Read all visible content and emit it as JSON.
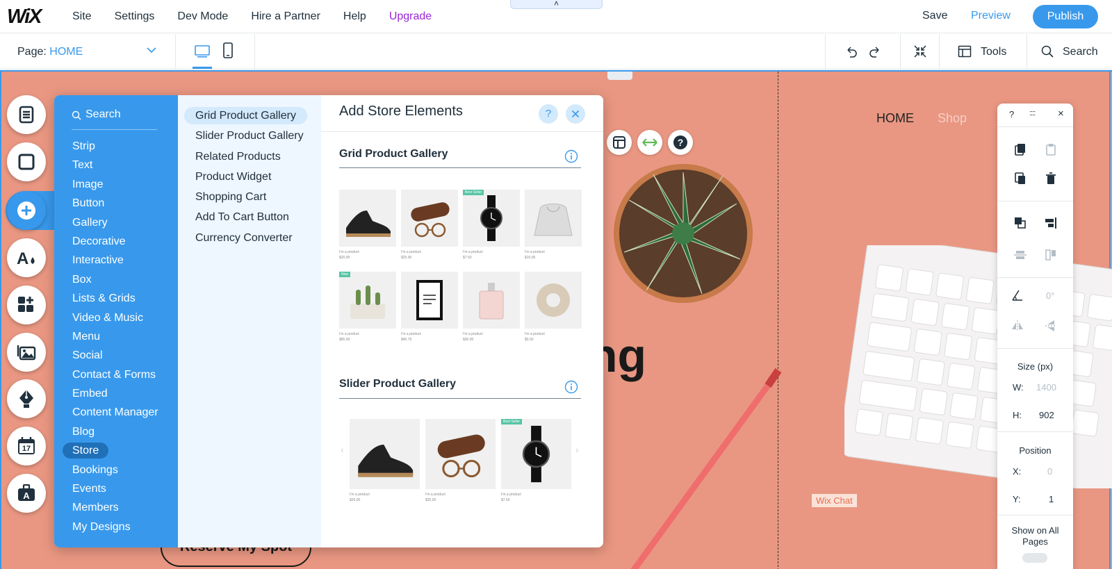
{
  "topbar": {
    "logo": "WiX",
    "menu": [
      "Site",
      "Settings",
      "Dev Mode",
      "Hire a Partner",
      "Help",
      "Upgrade"
    ],
    "collapse_glyph": "˄",
    "save": "Save",
    "preview": "Preview",
    "publish": "Publish"
  },
  "secondbar": {
    "page_prefix": "Page:",
    "page_name": "HOME",
    "tools": "Tools",
    "search": "Search"
  },
  "site": {
    "nav": [
      "HOME",
      "Shop"
    ],
    "headline_fragment": "ng",
    "cta": "Reserve My Spot",
    "chat_label": "Wix Chat"
  },
  "add_panel": {
    "search_placeholder": "Search",
    "categories": [
      "Strip",
      "Text",
      "Image",
      "Button",
      "Gallery",
      "Decorative",
      "Interactive",
      "Box",
      "Lists & Grids",
      "Video & Music",
      "Menu",
      "Social",
      "Contact & Forms",
      "Embed",
      "Content Manager",
      "Blog",
      "Store",
      "Bookings",
      "Events",
      "Members",
      "My Designs"
    ],
    "active_category": "Store",
    "subcategories": [
      "Grid Product Gallery",
      "Slider Product Gallery",
      "Related Products",
      "Product Widget",
      "Shopping Cart",
      "Add To Cart Button",
      "Currency Converter"
    ],
    "active_subcategory": "Grid Product Gallery",
    "title": "Add Store Elements",
    "help": "?",
    "sections": [
      {
        "title": "Grid Product Gallery"
      },
      {
        "title": "Slider Product Gallery"
      }
    ],
    "grid_products": [
      {
        "caption": "I'm a product",
        "price": "$20.00",
        "badge": ""
      },
      {
        "caption": "I'm a product",
        "price": "$25.00",
        "badge": ""
      },
      {
        "caption": "I'm a product",
        "price": "$7.50",
        "badge": "Best Seller"
      },
      {
        "caption": "I'm a product",
        "price": "$15.00",
        "badge": ""
      },
      {
        "caption": "I'm a product",
        "price": "$85.00",
        "badge": "New"
      },
      {
        "caption": "I'm a product",
        "price": "$40.75",
        "badge": ""
      },
      {
        "caption": "I'm a product",
        "price": "$30.00",
        "badge": ""
      },
      {
        "caption": "I'm a product",
        "price": "$9.50",
        "badge": ""
      }
    ],
    "slider_products": [
      {
        "caption": "I'm a product",
        "price": "$20.00",
        "badge": ""
      },
      {
        "caption": "I'm a product",
        "price": "$25.00",
        "badge": ""
      },
      {
        "caption": "I'm a product",
        "price": "$7.50",
        "badge": "Best Seller"
      }
    ],
    "slider_prev": "‹",
    "slider_next": "›"
  },
  "right_panel": {
    "help": "?",
    "drag": "::::",
    "close": "×",
    "angle": "0°",
    "size_label": "Size (px)",
    "w_label": "W:",
    "w_value": "1400",
    "h_label": "H:",
    "h_value": "902",
    "position_label": "Position",
    "x_label": "X:",
    "x_value": "0",
    "y_label": "Y:",
    "y_value": "1",
    "show_all_pages": "Show on All Pages"
  },
  "colors": {
    "accent": "#3899ec",
    "canvas_bg": "#e99782",
    "upgrade": "#9a27d5"
  }
}
